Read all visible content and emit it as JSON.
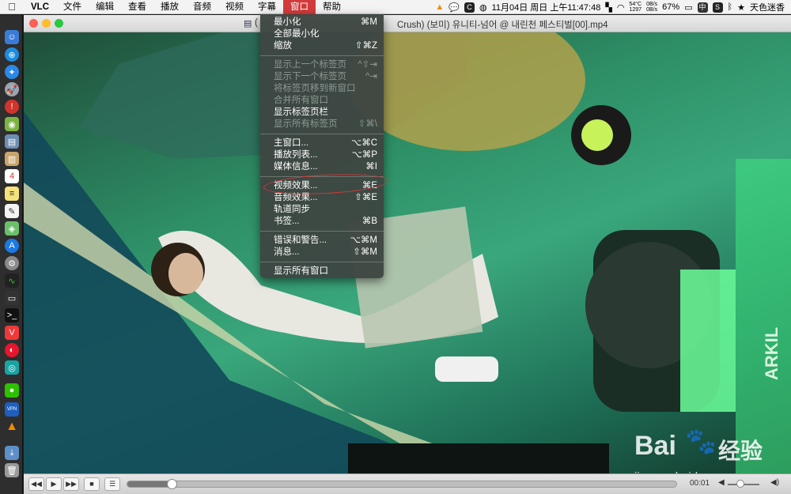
{
  "menubar": {
    "app": "VLC",
    "items": [
      "文件",
      "编辑",
      "查看",
      "播放",
      "音频",
      "视频",
      "字幕",
      "窗口",
      "帮助"
    ],
    "active": "窗口",
    "status": {
      "temp_top": "54°C",
      "temp_bottom": "1297",
      "net_up": "0B/s",
      "net_down": "0B/s",
      "datetime": "11月04日 周日 上午11:47:48",
      "battery": "67%",
      "input": "中",
      "user": "天色迷香"
    }
  },
  "window": {
    "title": "Crush) (보미) 유니티-넘어 @ 내린천 페스티벌[00].mp4",
    "title_prefix": "(",
    "colors": {
      "close": "#fd5f57",
      "minimize": "#febc2e",
      "zoom": "#28c840"
    }
  },
  "menu": {
    "groups": [
      [
        {
          "label": "最小化",
          "shortcut": "⌘M",
          "enabled": true
        },
        {
          "label": "全部最小化",
          "shortcut": "",
          "enabled": true
        },
        {
          "label": "缩放",
          "shortcut": "⇧⌘Z",
          "enabled": true
        }
      ],
      [
        {
          "label": "显示上一个标签页",
          "shortcut": "^⇧⇥",
          "enabled": false
        },
        {
          "label": "显示下一个标签页",
          "shortcut": "^⇥",
          "enabled": false
        },
        {
          "label": "将标签页移到新窗口",
          "shortcut": "",
          "enabled": false
        },
        {
          "label": "合并所有窗口",
          "shortcut": "",
          "enabled": false
        },
        {
          "label": "显示标签页栏",
          "shortcut": "",
          "enabled": true
        },
        {
          "label": "显示所有标签页",
          "shortcut": "⇧⌘\\",
          "enabled": false
        }
      ],
      [
        {
          "label": "主窗口...",
          "shortcut": "⌥⌘C",
          "enabled": true
        },
        {
          "label": "播放列表...",
          "shortcut": "⌥⌘P",
          "enabled": true
        },
        {
          "label": "媒体信息...",
          "shortcut": "⌘I",
          "enabled": true
        }
      ],
      [
        {
          "label": "视频效果...",
          "shortcut": "⌘E",
          "enabled": true,
          "highlight": true
        },
        {
          "label": "音频效果...",
          "shortcut": "⇧⌘E",
          "enabled": true
        },
        {
          "label": "轨道同步",
          "shortcut": "",
          "enabled": true
        },
        {
          "label": "书签...",
          "shortcut": "⌘B",
          "enabled": true
        }
      ],
      [
        {
          "label": "错误和警告...",
          "shortcut": "⌥⌘M",
          "enabled": true
        },
        {
          "label": "消息...",
          "shortcut": "⇧⌘M",
          "enabled": true
        }
      ],
      [
        {
          "label": "显示所有窗口",
          "shortcut": "",
          "enabled": true
        }
      ]
    ],
    "highlight_color": "#d03a3a"
  },
  "controls": {
    "time": "00:01",
    "progress": 0.08,
    "volume": 0.4
  },
  "watermark": {
    "brand": "Bai",
    "brand_cn": "经验",
    "url": "jingyan.baidu.com"
  },
  "video_overlay_text": "ARKIL"
}
